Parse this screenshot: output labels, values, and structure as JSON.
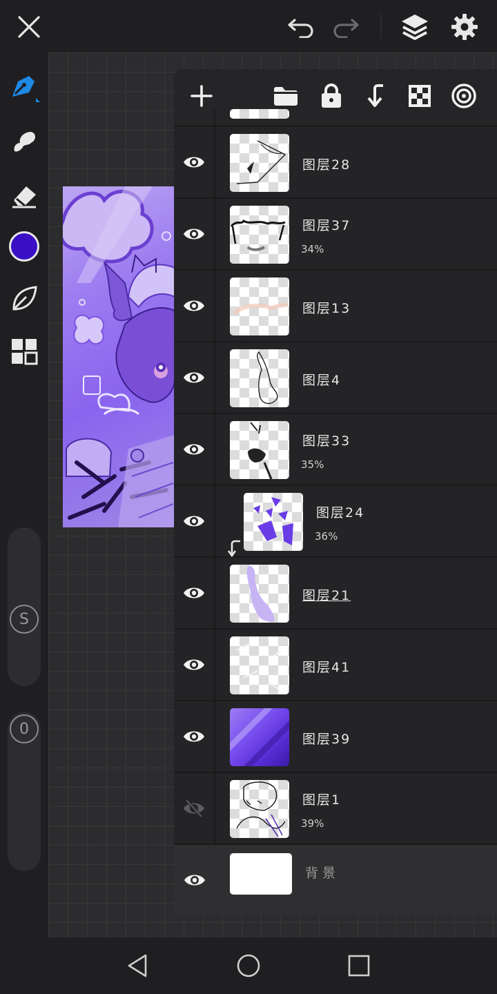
{
  "topbar": {
    "close_icon": "close-icon",
    "undo_icon": "undo-icon",
    "redo_icon": "redo-icon",
    "layers_icon": "layers-icon",
    "settings_icon": "gear-icon"
  },
  "tools": {
    "items": [
      "pen-icon",
      "smudge-icon",
      "eraser-icon",
      "color-swatch",
      "blend-leaf-icon",
      "gallery-grid-icon"
    ],
    "current_color": "#3a0fc6",
    "size_label": "S",
    "opacity_label": "0"
  },
  "layer_panel": {
    "header_icons": [
      "add-layer-icon",
      "folder-icon",
      "lock-icon",
      "merge-down-icon",
      "transparency-icon",
      "blend-mode-icon"
    ],
    "layers": [
      {
        "name": "图层28",
        "opacity": "",
        "visible": true,
        "clipped": false,
        "selected": false
      },
      {
        "name": "图层37",
        "opacity": "34%",
        "visible": true,
        "clipped": false,
        "selected": false
      },
      {
        "name": "图层13",
        "opacity": "",
        "visible": true,
        "clipped": false,
        "selected": false
      },
      {
        "name": "图层4",
        "opacity": "",
        "visible": true,
        "clipped": false,
        "selected": false
      },
      {
        "name": "图层33",
        "opacity": "35%",
        "visible": true,
        "clipped": false,
        "selected": false
      },
      {
        "name": "图层24",
        "opacity": "36%",
        "visible": true,
        "clipped": true,
        "selected": false
      },
      {
        "name": "图层21",
        "opacity": "",
        "visible": true,
        "clipped": false,
        "selected": true
      },
      {
        "name": "图层41",
        "opacity": "",
        "visible": true,
        "clipped": false,
        "selected": false
      },
      {
        "name": "图层39",
        "opacity": "",
        "visible": true,
        "clipped": false,
        "selected": false
      },
      {
        "name": "图层1",
        "opacity": "39%",
        "visible": false,
        "clipped": false,
        "selected": false
      },
      {
        "name": "背景",
        "opacity": "",
        "visible": true,
        "clipped": false,
        "selected": false
      }
    ]
  },
  "navbar": {
    "back_icon": "back-triangle-icon",
    "home_icon": "home-circle-icon",
    "recents_icon": "recents-square-icon"
  },
  "colors": {
    "accent": "#1e88e5",
    "background": "#1f1f21",
    "panel": "#242426",
    "art_purple": "#8a64ee"
  }
}
